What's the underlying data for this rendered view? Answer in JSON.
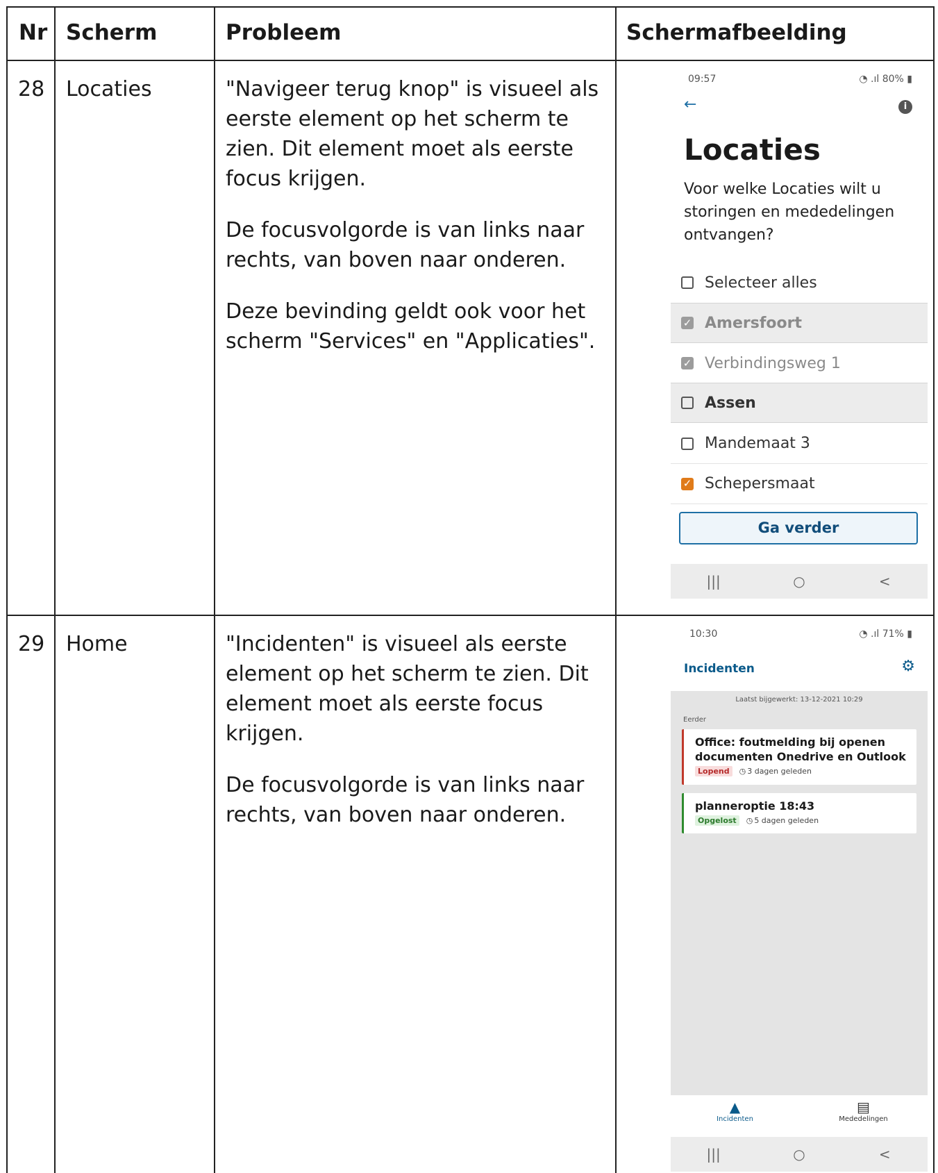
{
  "table": {
    "headers": {
      "nr": "Nr",
      "scherm": "Scherm",
      "probleem": "Probleem",
      "schermafbeelding": "Schermafbeelding"
    },
    "rows": [
      {
        "nr": "28",
        "scherm": "Locaties",
        "probleem": [
          "\"Navigeer terug knop\" is visueel als eerste element op het scherm te zien. Dit element moet als eerste focus krijgen.",
          "De focusvolgorde is van links naar rechts, van boven naar onderen.",
          "Deze bevinding geldt ook voor het scherm \"Services\" en \"Applicaties\"."
        ]
      },
      {
        "nr": "29",
        "scherm": "Home",
        "probleem": [
          "\"Incidenten\" is visueel als eerste element op het scherm te zien. Dit element moet als eerste focus krijgen.",
          "De focusvolgorde is van links naar rechts, van boven naar onderen."
        ]
      }
    ]
  },
  "screen_locaties": {
    "time": "09:57",
    "battery": "80%",
    "back_icon": "arrow-left-icon",
    "info_icon": "info-icon",
    "title": "Locaties",
    "subtitle": "Voor welke Locaties wilt u storingen en mededelingen ontvangen?",
    "items": [
      {
        "label": "Selecteer alles",
        "checked": false
      },
      {
        "label": "Amersfoort",
        "checked": true
      },
      {
        "label": "Verbindingsweg 1",
        "checked": true
      },
      {
        "label": "Assen",
        "checked": false
      },
      {
        "label": "Mandemaat 3",
        "checked": false
      },
      {
        "label": "Schepersmaat",
        "checked": true
      }
    ],
    "button": "Ga verder"
  },
  "screen_home": {
    "time": "10:30",
    "battery": "71%",
    "header_title": "Incidenten",
    "settings_icon": "gear-icon",
    "updated": "Laatst bijgewerkt: 13-12-2021 10:29",
    "section": "Eerder",
    "cards": [
      {
        "title": "Office: foutmelding bij openen documenten Onedrive en Outlook",
        "status": "Lopend",
        "age": "3 dagen geleden"
      },
      {
        "title": "planneroptie 18:43",
        "status": "Opgelost",
        "age": "5 dagen geleden"
      }
    ],
    "tabs": [
      {
        "label": "Incidenten",
        "icon": "warning-icon"
      },
      {
        "label": "Mededelingen",
        "icon": "message-icon"
      }
    ]
  },
  "android_nav": {
    "recents": "|||",
    "home": "○",
    "back": "<"
  },
  "colors": {
    "accent_blue": "#0a5a8a",
    "check_orange": "#e07b1a",
    "status_red": "#c0392b",
    "status_green": "#2e8b2e"
  }
}
